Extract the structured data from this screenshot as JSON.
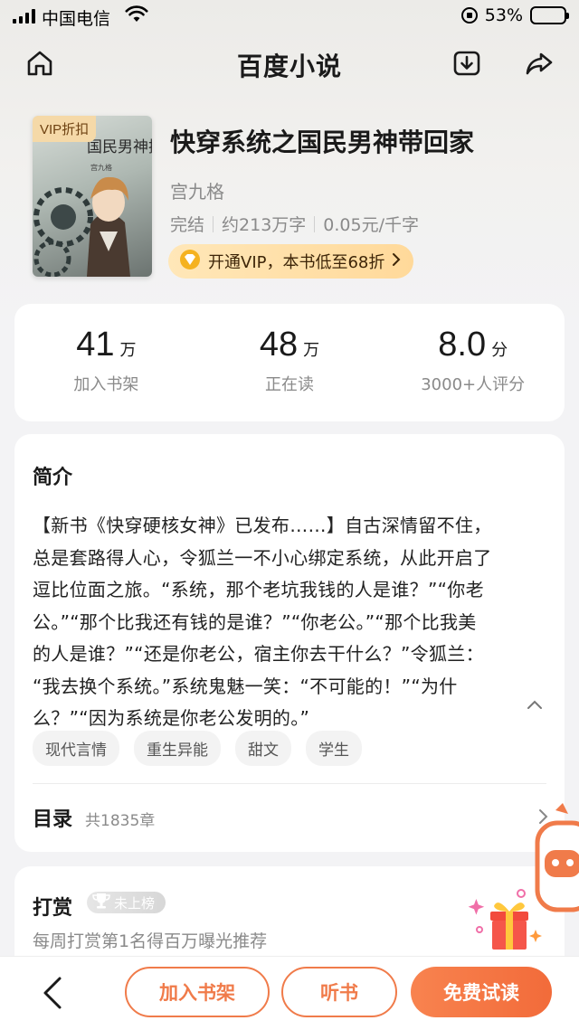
{
  "status_bar": {
    "carrier": "中国电信",
    "battery": "53%",
    "battery_level": 0.53
  },
  "nav": {
    "title": "百度小说"
  },
  "book": {
    "vip_tag": "VIP折扣",
    "title": "快穿系统之国民男神带回家",
    "author": "宫九格",
    "status": "完结",
    "word_count": "约213万字",
    "price": "0.05元/千字",
    "vip_banner": "开通VIP，本书低至68折",
    "cover_title": "国民男神撩回家",
    "cover_author": "宫九格"
  },
  "stats": [
    {
      "value": "41",
      "unit": "万",
      "label": "加入书架"
    },
    {
      "value": "48",
      "unit": "万",
      "label": "正在读"
    },
    {
      "value": "8.0",
      "unit": "分",
      "label": "3000+人评分"
    }
  ],
  "intro": {
    "heading": "简介",
    "lines": [
      "【新书《快穿硬核女神》已发布……】自古深情留不住，",
      "总是套路得人心，令狐兰一不小心绑定系统，从此开启了",
      "逗比位面之旅。“系统，那个老坑我钱的人是谁？”“你老",
      "公。”“那个比我还有钱的是谁？”“你老公。”“那个比我美",
      "的人是谁？”“还是你老公，宿主你去干什么？”令狐兰：",
      "“我去换个系统。”系统鬼魅一笑：“不可能的！”“为什",
      "么？”“因为系统是你老公发明的。”"
    ],
    "tags": [
      "现代言情",
      "重生异能",
      "甜文",
      "学生"
    ]
  },
  "toc": {
    "heading": "目录",
    "count": "共1835章"
  },
  "reward": {
    "heading": "打赏",
    "rank_badge": "未上榜",
    "subtitle": "每周打赏第1名得百万曝光推荐"
  },
  "bottom_bar": {
    "add_shelf": "加入书架",
    "listen": "听书",
    "free_read": "免费试读"
  },
  "colors": {
    "accent": "#f26b3a",
    "vip_gold": "#ffd99a"
  }
}
